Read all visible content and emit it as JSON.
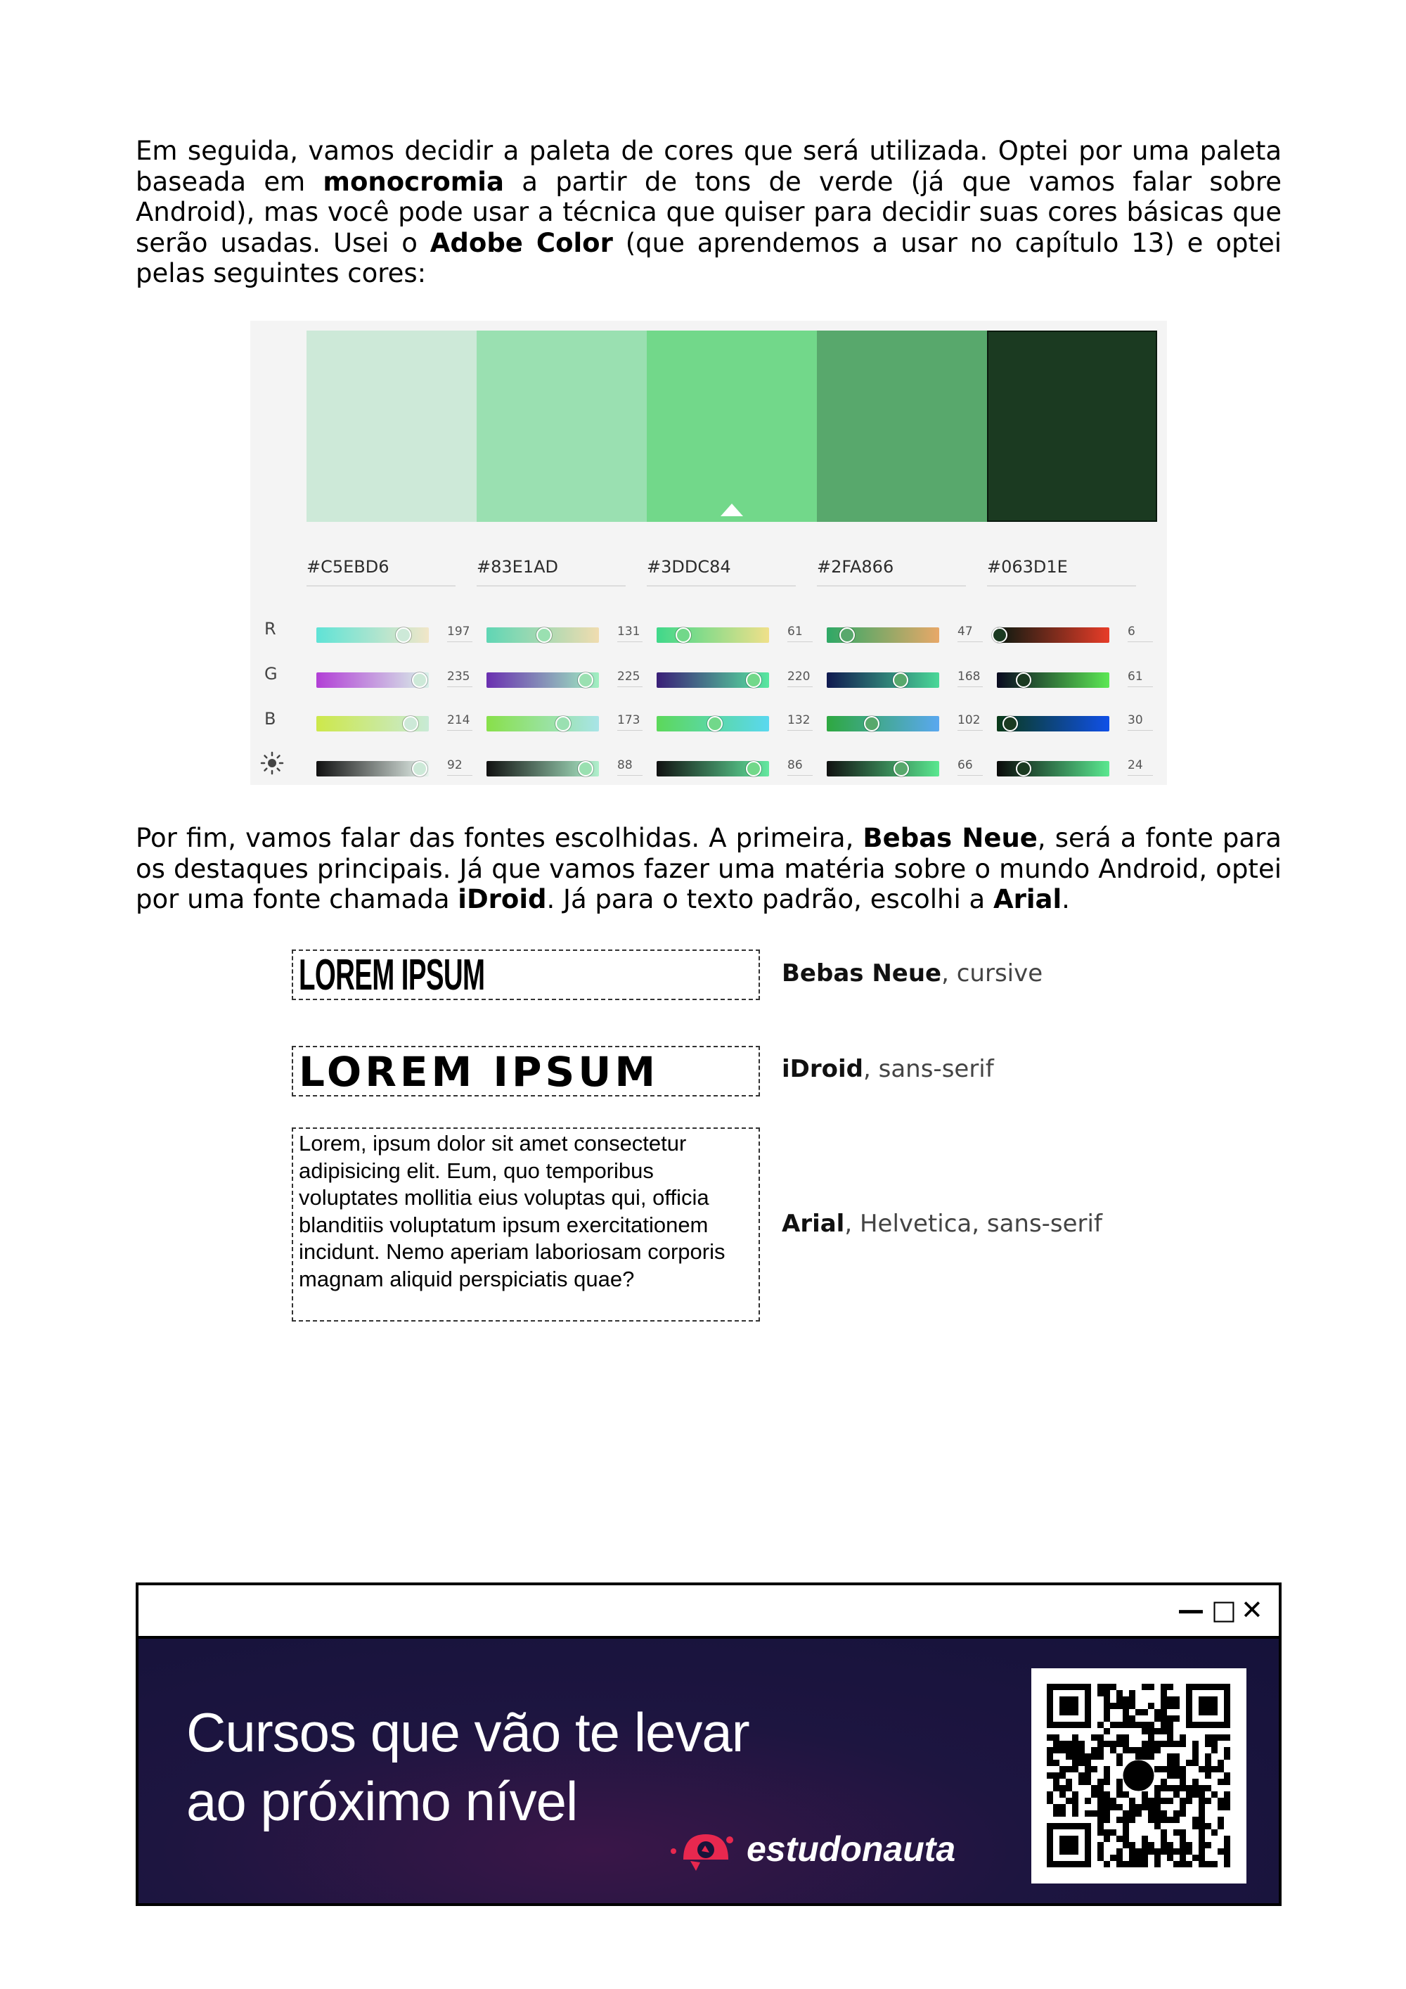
{
  "intro": {
    "t1": "Em seguida, vamos decidir a paleta de cores que será utilizada. Optei por uma paleta baseada em ",
    "b1": "monocromia",
    "t2": " a partir de tons de verde (já que vamos falar sobre Android), mas você pode usar a técnica que quiser para decidir suas cores básicas que serão usadas. Usei o ",
    "b2": "Adobe Color",
    "t3": " (que aprendemos a usar no capítulo 13) e optei pelas seguintes cores:"
  },
  "palette": {
    "swatches": [
      {
        "hex": "#C5EBD6",
        "color": "#cde9d8",
        "r": 197,
        "g": 235,
        "b": 214,
        "l": 92
      },
      {
        "hex": "#83E1AD",
        "color": "#9ae0b1",
        "r": 131,
        "g": 225,
        "b": 173,
        "l": 88
      },
      {
        "hex": "#3DDC84",
        "color": "#72d88a",
        "r": 61,
        "g": 220,
        "b": 132,
        "l": 86
      },
      {
        "hex": "#2FA866",
        "color": "#58a86c",
        "r": 47,
        "g": 168,
        "b": 102,
        "l": 66
      },
      {
        "hex": "#063D1E",
        "color": "#1b3a21",
        "r": 6,
        "g": 61,
        "b": 30,
        "l": 24
      }
    ],
    "selected_index": 2,
    "channels": [
      "R",
      "G",
      "B"
    ],
    "brightness_icon": "sun-icon"
  },
  "fonts_para": {
    "t1": "Por fim, vamos falar das fontes escolhidas. A primeira, ",
    "b1": "Bebas Neue",
    "t2": ", será a fonte para os destaques principais. Já que vamos fazer uma matéria sobre o mundo Android, optei por uma fonte chamada ",
    "b2": "iDroid",
    "t3": ". Já para o texto padrão, escolhi a ",
    "b3": "Arial",
    "t4": "."
  },
  "font_samples": [
    {
      "sample": "LOREM IPSUM",
      "name": "Bebas Neue",
      "fallback": ", cursive"
    },
    {
      "sample": "LOREM IPSUM",
      "name": "iDroid",
      "fallback": ", sans-serif"
    },
    {
      "sample": "Lorem, ipsum dolor sit amet consectetur adipisicing elit. Eum, quo temporibus voluptates mollitia eius voluptas qui, officia blanditiis voluptatum ipsum exercitationem incidunt. Nemo aperiam laboriosam corporis magnam aliquid perspiciatis quae?",
      "name": "Arial",
      "fallback": ", Helvetica, sans-serif"
    }
  ],
  "ad": {
    "headline_line1": "Cursos que vão te levar",
    "headline_line2": "ao próximo nível",
    "brand": "estudonauta",
    "window_controls": [
      "—",
      "□",
      "✕"
    ],
    "brand_color": "#e8284f"
  }
}
